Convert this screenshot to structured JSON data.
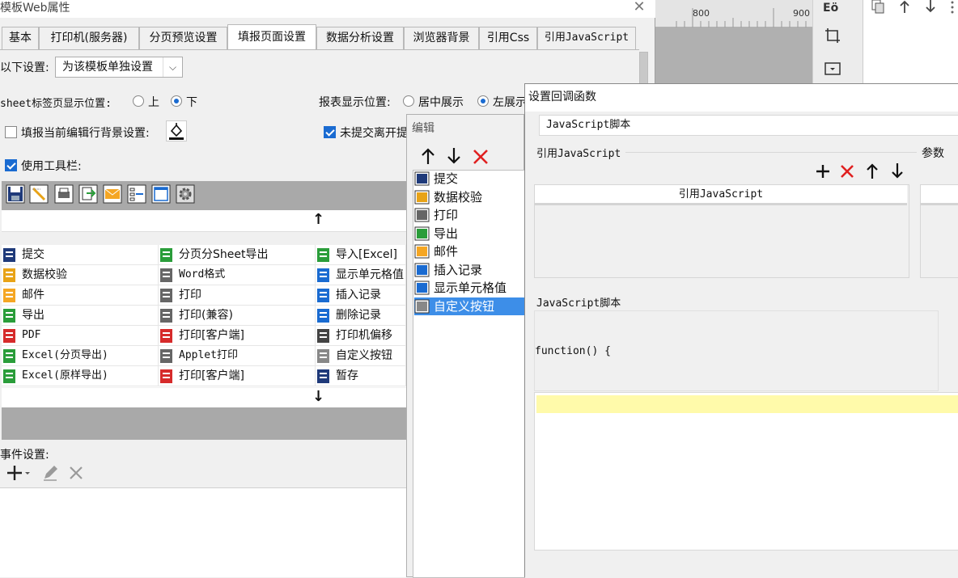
{
  "background": {
    "ruler_ticks": [
      "800",
      "900"
    ]
  },
  "main_dialog": {
    "title": "模板Web属性",
    "close": "✕",
    "tabs": [
      {
        "label": "基本",
        "active": false
      },
      {
        "label": "打印机(服务器)",
        "active": false
      },
      {
        "label": "分页预览设置",
        "active": false
      },
      {
        "label": "填报页面设置",
        "active": true
      },
      {
        "label": "数据分析设置",
        "active": false
      },
      {
        "label": "浏览器背景",
        "active": false
      },
      {
        "label": "引用Css",
        "active": false
      },
      {
        "label": "引用JavaScript",
        "active": false
      }
    ],
    "settings_label": "以下设置:",
    "settings_select": "为该模板单独设置",
    "sheet_pos_label": "sheet标签页显示位置:",
    "sheet_pos_options": [
      "上",
      "下"
    ],
    "sheet_pos_selected": "下",
    "report_pos_label": "报表显示位置:",
    "report_pos_options": [
      "居中展示",
      "左展示"
    ],
    "report_pos_selected": "左展示",
    "bg_setting_label": "填报当前编辑行背景设置:",
    "bg_setting_checked": false,
    "unsubmitted_label": "未提交离开提",
    "unsubmitted_checked": true,
    "use_toolbar_label": "使用工具栏:",
    "use_toolbar_checked": true,
    "nav_up": "↑",
    "nav_down": "↓",
    "grid": [
      [
        "提交",
        "分页分Sheet导出",
        "导入[Excel]"
      ],
      [
        "数据校验",
        "Word格式",
        "显示单元格值"
      ],
      [
        "邮件",
        "打印",
        "插入记录"
      ],
      [
        "导出",
        "打印(兼容)",
        "删除记录"
      ],
      [
        "PDF",
        "打印[客户端]",
        "打印机偏移"
      ],
      [
        "Excel(分页导出)",
        "Applet打印",
        "自定义按钮"
      ],
      [
        "Excel(原样导出)",
        "打印[客户端]",
        "暂存"
      ]
    ],
    "event_label": "事件设置:"
  },
  "edit_dialog": {
    "title": "编辑",
    "items": [
      "提交",
      "数据校验",
      "打印",
      "导出",
      "邮件",
      "插入记录",
      "显示单元格值",
      "自定义按钮"
    ],
    "selected": "自定义按钮"
  },
  "callback_dialog": {
    "title": "设置回调函数",
    "type_value": "JavaScript脚本",
    "ref_js_section": "引用JavaScript",
    "params_section": "参数",
    "ref_js_column": "引用JavaScript",
    "script_section": "JavaScript脚本",
    "function_text": "function() {"
  },
  "colors": {
    "accent": "#1a6bd1",
    "selection": "#3d8ee8",
    "delete_red": "#e02020",
    "editor_highlight": "#fffaaa"
  }
}
